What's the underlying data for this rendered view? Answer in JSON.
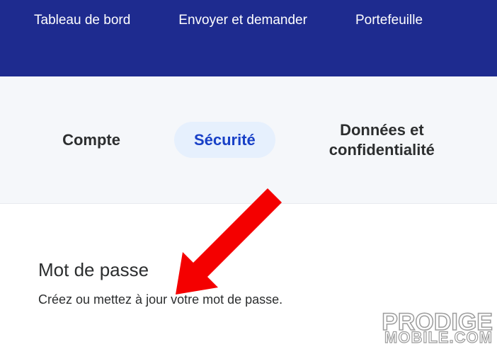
{
  "topNav": {
    "items": [
      {
        "label": "Tableau de bord"
      },
      {
        "label": "Envoyer et demander"
      },
      {
        "label": "Portefeuille"
      }
    ]
  },
  "subNav": {
    "items": [
      {
        "label": "Compte",
        "active": false
      },
      {
        "label": "Sécurité",
        "active": true
      },
      {
        "label": "Données et\nconfidentialité",
        "active": false
      }
    ]
  },
  "section": {
    "title": "Mot de passe",
    "description": "Créez ou mettez à jour votre mot de passe."
  },
  "watermark": {
    "line1": "PRODIGE",
    "line2": "MOBILE.COM"
  },
  "colors": {
    "navBg": "#1e2b8f",
    "subNavBg": "#f5f7fa",
    "activeTabBg": "#e6f0fd",
    "activeTabText": "#1840c7",
    "arrow": "#f40000"
  }
}
